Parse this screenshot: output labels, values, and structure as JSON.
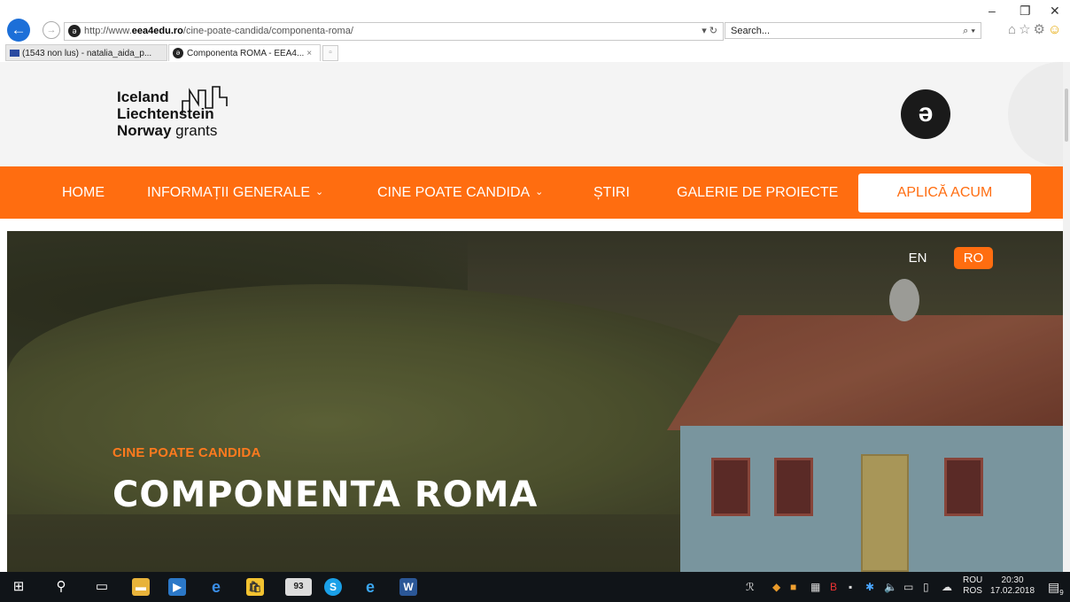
{
  "browser": {
    "address_url_prefix": "http://www.",
    "address_host": "eea4edu.ro",
    "address_path": "/cine-poate-candida/componenta-roma/",
    "address_tools": "▾ ↻",
    "search_placeholder": "Search...",
    "search_icon": "⌕ ▾",
    "window_minimize": "–",
    "window_restore": "❐",
    "window_close": "✕",
    "tabs": [
      {
        "label": "(1543 non lus) - natalia_aida_p...",
        "icon": "mail-icon"
      },
      {
        "label": "Componenta ROMA - EEA4...",
        "icon": "site-icon",
        "close": "×"
      }
    ]
  },
  "site": {
    "logo": {
      "line1": "Iceland",
      "line2": "Liechtenstein",
      "line3_bold": "Norway",
      "line3_light": " grants"
    },
    "brand_icon": "ə",
    "nav": {
      "items": [
        {
          "label": "HOME"
        },
        {
          "label": "INFORMAȚII GENERALE",
          "caret": "⌄"
        },
        {
          "label": "CINE POATE CANDIDA",
          "caret": "⌄"
        },
        {
          "label": "ȘTIRI"
        },
        {
          "label": "GALERIE DE PROIECTE"
        }
      ],
      "apply_label": "APLICĂ ACUM"
    },
    "languages": {
      "en": "EN",
      "ro": "RO"
    },
    "hero": {
      "kicker": "CINE POATE CANDIDA",
      "title": "COMPONENTA ROMA"
    }
  },
  "taskbar": {
    "language_top": "ROU",
    "language_bottom": "ROS",
    "time": "20:30",
    "date": "17.02.2018",
    "notification_count": "9",
    "mail_badge": "93"
  },
  "colors": {
    "accent_orange": "#ff6d10",
    "browser_blue": "#1c6fd8",
    "taskbar_bg": "#101418"
  }
}
